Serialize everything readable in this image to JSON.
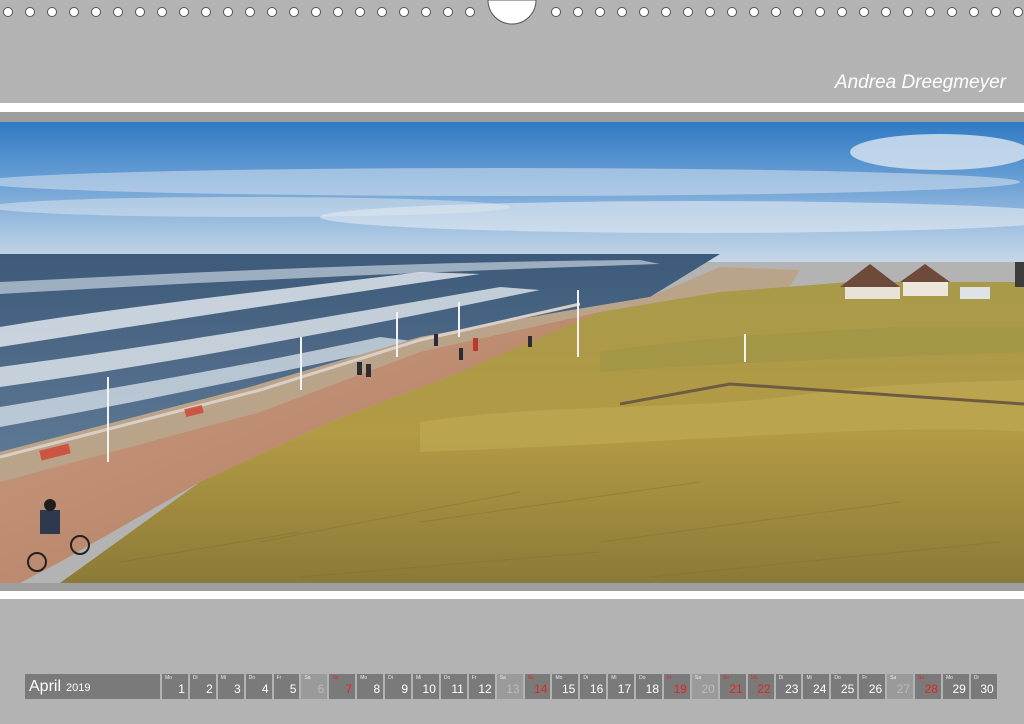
{
  "author": "Andrea Dreegmeyer",
  "calendar": {
    "month": "April",
    "year": "2019",
    "days": [
      {
        "wd": "Mo",
        "n": "1",
        "k": ""
      },
      {
        "wd": "Di",
        "n": "2",
        "k": ""
      },
      {
        "wd": "Mi",
        "n": "3",
        "k": ""
      },
      {
        "wd": "Do",
        "n": "4",
        "k": ""
      },
      {
        "wd": "Fr",
        "n": "5",
        "k": ""
      },
      {
        "wd": "Sa",
        "n": "6",
        "k": "sat"
      },
      {
        "wd": "So",
        "n": "7",
        "k": "red"
      },
      {
        "wd": "Mo",
        "n": "8",
        "k": ""
      },
      {
        "wd": "Di",
        "n": "9",
        "k": ""
      },
      {
        "wd": "Mi",
        "n": "10",
        "k": ""
      },
      {
        "wd": "Do",
        "n": "11",
        "k": ""
      },
      {
        "wd": "Fr",
        "n": "12",
        "k": ""
      },
      {
        "wd": "Sa",
        "n": "13",
        "k": "sat"
      },
      {
        "wd": "So",
        "n": "14",
        "k": "red"
      },
      {
        "wd": "Mo",
        "n": "15",
        "k": ""
      },
      {
        "wd": "Di",
        "n": "16",
        "k": ""
      },
      {
        "wd": "Mi",
        "n": "17",
        "k": ""
      },
      {
        "wd": "Do",
        "n": "18",
        "k": ""
      },
      {
        "wd": "Fr",
        "n": "19",
        "k": "red"
      },
      {
        "wd": "Sa",
        "n": "20",
        "k": "sat"
      },
      {
        "wd": "So",
        "n": "21",
        "k": "red"
      },
      {
        "wd": "Mo",
        "n": "22",
        "k": "red"
      },
      {
        "wd": "Di",
        "n": "23",
        "k": ""
      },
      {
        "wd": "Mi",
        "n": "24",
        "k": ""
      },
      {
        "wd": "Do",
        "n": "25",
        "k": ""
      },
      {
        "wd": "Fr",
        "n": "26",
        "k": ""
      },
      {
        "wd": "Sa",
        "n": "27",
        "k": "sat"
      },
      {
        "wd": "So",
        "n": "28",
        "k": "red"
      },
      {
        "wd": "Mo",
        "n": "29",
        "k": ""
      },
      {
        "wd": "Di",
        "n": "30",
        "k": ""
      }
    ]
  },
  "colors": {
    "background": "#b3b3b3",
    "calendar_cell": "#7a7a7a",
    "holiday_red": "#e3241c"
  }
}
